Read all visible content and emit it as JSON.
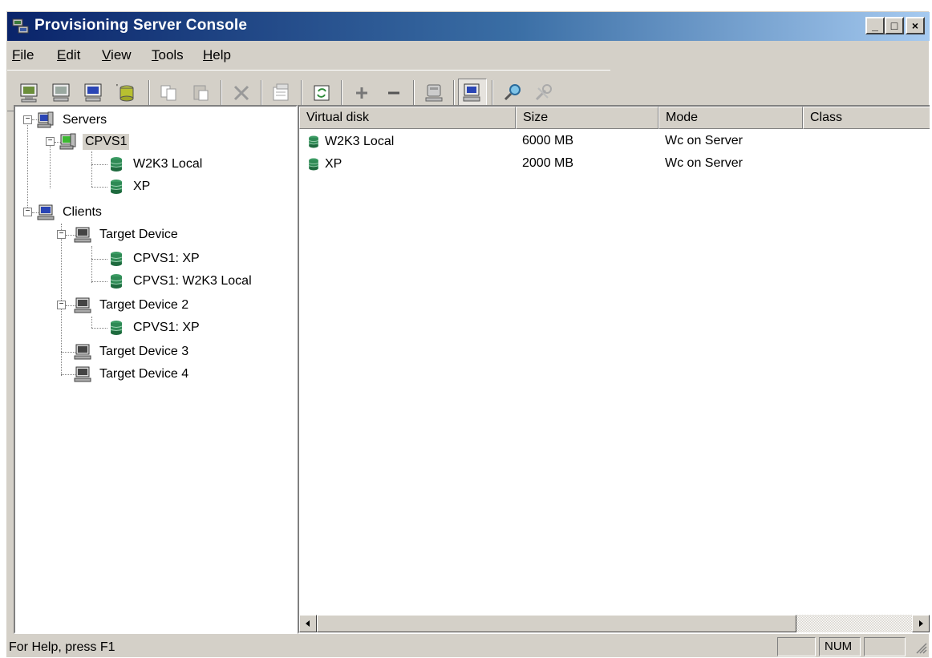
{
  "window": {
    "title": "Provisioning Server Console",
    "controls": {
      "minimize": "_",
      "maximize": "□",
      "close": "×"
    }
  },
  "menubar": [
    {
      "label": "File",
      "mnemonic": "F"
    },
    {
      "label": "Edit",
      "mnemonic": "E"
    },
    {
      "label": "View",
      "mnemonic": "V"
    },
    {
      "label": "Tools",
      "mnemonic": "T"
    },
    {
      "label": "Help",
      "mnemonic": "H"
    }
  ],
  "toolbar": {
    "buttons": [
      {
        "icon": "monitor-add-icon"
      },
      {
        "icon": "monitor-green-icon"
      },
      {
        "icon": "monitor-blue-icon"
      },
      {
        "icon": "database-add-icon"
      },
      {
        "icon": "copy-icon"
      },
      {
        "icon": "paste-icon"
      },
      {
        "icon": "delete-icon"
      },
      {
        "icon": "properties-icon"
      },
      {
        "icon": "refresh-icon"
      },
      {
        "icon": "plus-icon"
      },
      {
        "icon": "minus-icon"
      },
      {
        "icon": "server-icon"
      },
      {
        "icon": "client-icon",
        "pressed": true
      },
      {
        "icon": "find-icon"
      },
      {
        "icon": "tools-icon"
      }
    ]
  },
  "tree": {
    "servers_label": "Servers",
    "server_name": "CPVS1",
    "server_disks": [
      "W2K3 Local",
      "XP"
    ],
    "clients_label": "Clients",
    "devices": [
      {
        "name": "Target Device",
        "disks": [
          "CPVS1: XP",
          "CPVS1: W2K3 Local"
        ]
      },
      {
        "name": "Target Device 2",
        "disks": [
          "CPVS1: XP"
        ]
      },
      {
        "name": "Target Device 3",
        "disks": []
      },
      {
        "name": "Target Device 4",
        "disks": []
      }
    ]
  },
  "list": {
    "columns": [
      "Virtual disk",
      "Size",
      "Mode",
      "Class"
    ],
    "rows": [
      {
        "name": "W2K3 Local",
        "size": "6000 MB",
        "mode": "Wc on Server",
        "class": ""
      },
      {
        "name": "XP",
        "size": "2000 MB",
        "mode": "Wc on Server",
        "class": ""
      }
    ]
  },
  "status": {
    "text": "For Help, press F1",
    "panel_num": "NUM"
  },
  "colors": {
    "titlebar_start": "#0a246a",
    "titlebar_end": "#a6caf0",
    "face": "#d4d0c8",
    "disk_green": "#2f8a55"
  }
}
